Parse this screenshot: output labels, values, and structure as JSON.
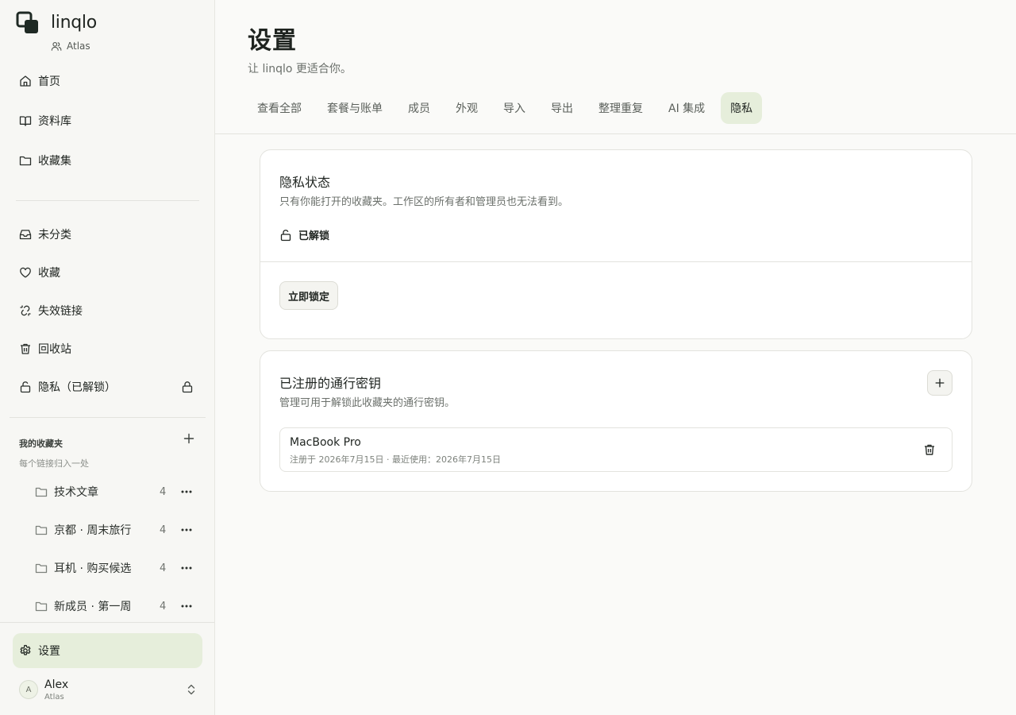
{
  "app": {
    "name": "linqlo",
    "workspace": "Atlas"
  },
  "sidebar": {
    "nav": [
      {
        "label": "首页",
        "icon": "home-icon"
      },
      {
        "label": "资料库",
        "icon": "book-open-icon"
      },
      {
        "label": "收藏集",
        "icon": "folder-icon"
      }
    ],
    "system": [
      {
        "label": "未分类",
        "icon": "inbox-icon"
      },
      {
        "label": "收藏",
        "icon": "heart-icon"
      },
      {
        "label": "失效链接",
        "icon": "broken-link-icon"
      },
      {
        "label": "回收站",
        "icon": "trash-icon"
      },
      {
        "label": "隐私（已解锁）",
        "icon": "unlock-icon",
        "trailing_icon": "lock-icon"
      }
    ],
    "collections": {
      "title": "我的收藏夹",
      "subtitle": "每个链接归入一处",
      "items": [
        {
          "label": "技术文章",
          "count": "4"
        },
        {
          "label": "京都 · 周末旅行",
          "count": "4"
        },
        {
          "label": "耳机 · 购买候选",
          "count": "4"
        },
        {
          "label": "新成员 · 第一周",
          "count": "4"
        }
      ]
    },
    "settings_label": "设置",
    "user": {
      "initial": "A",
      "name": "Alex",
      "workspace": "Atlas"
    }
  },
  "page": {
    "title": "设置",
    "subtitle": "让 linqlo 更适合你。",
    "tabs": [
      {
        "label": "查看全部",
        "active": false
      },
      {
        "label": "套餐与账单",
        "active": false
      },
      {
        "label": "成员",
        "active": false
      },
      {
        "label": "外观",
        "active": false
      },
      {
        "label": "导入",
        "active": false
      },
      {
        "label": "导出",
        "active": false
      },
      {
        "label": "整理重复",
        "active": false
      },
      {
        "label": "AI 集成",
        "active": false
      },
      {
        "label": "隐私",
        "active": true
      }
    ]
  },
  "privacy": {
    "title": "隐私状态",
    "description": "只有你能打开的收藏夹。工作区的所有者和管理员也无法看到。",
    "status": "已解锁",
    "lock_button": "立即锁定"
  },
  "passkeys": {
    "title": "已注册的通行密钥",
    "description": "管理可用于解锁此收藏夹的通行密钥。",
    "items": [
      {
        "name": "MacBook Pro",
        "meta": "注册于 2026年7月15日 · 最近使用：2026年7月15日"
      }
    ]
  },
  "colors": {
    "accent_bg": "#e6eedb",
    "text": "#1f2420",
    "muted": "#6b706b"
  }
}
